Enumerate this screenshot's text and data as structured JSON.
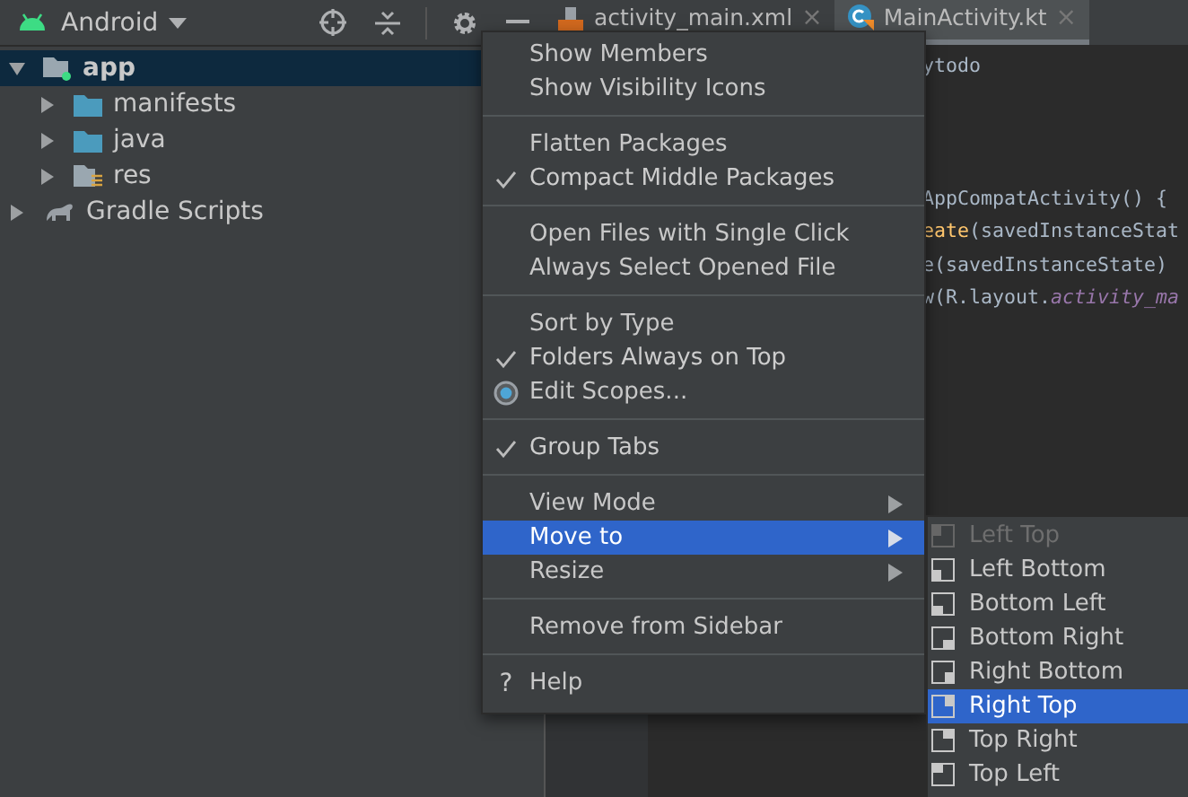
{
  "toolbar": {
    "view": "Android"
  },
  "tabs": [
    {
      "label": "activity_main.xml",
      "selected": false,
      "kind": "xml",
      "close": "×"
    },
    {
      "label": "MainActivity.kt",
      "selected": true,
      "kind": "kotlin",
      "close": "×"
    }
  ],
  "tree": [
    {
      "label": "app",
      "kind": "module",
      "expanded": true,
      "selected": true,
      "children": [
        {
          "label": "manifests",
          "kind": "folder",
          "expanded": false,
          "selected": false
        },
        {
          "label": "java",
          "kind": "folder",
          "expanded": false,
          "selected": false
        },
        {
          "label": "res",
          "kind": "res",
          "expanded": false,
          "selected": false
        }
      ]
    },
    {
      "label": "Gradle Scripts",
      "kind": "gradle",
      "expanded": false,
      "selected": false
    }
  ],
  "code": [
    [
      {
        "text": "ytodo",
        "kind": "plain"
      }
    ],
    [
      {
        "text": "AppCompatActivity() {",
        "kind": "plain"
      }
    ],
    [
      {
        "text": "eate",
        "kind": "function"
      },
      {
        "text": "(savedInstanceStat",
        "kind": "plain"
      }
    ],
    [
      {
        "text": "e(savedInstanceState)",
        "kind": "plain"
      }
    ],
    [
      {
        "text": "w(R.layout.",
        "kind": "plain"
      },
      {
        "text": "activity_ma",
        "kind": "field"
      }
    ]
  ],
  "menu": [
    {
      "kind": "toggle",
      "label": "Show Members",
      "checked": false,
      "selected": false
    },
    {
      "kind": "toggle",
      "label": "Show Visibility Icons",
      "checked": false,
      "selected": false
    },
    {
      "kind": "separator"
    },
    {
      "kind": "toggle",
      "label": "Flatten Packages",
      "checked": false,
      "selected": false
    },
    {
      "kind": "toggle",
      "label": "Compact Middle Packages",
      "checked": true,
      "selected": false
    },
    {
      "kind": "separator"
    },
    {
      "kind": "toggle",
      "label": "Open Files with Single Click",
      "checked": false,
      "selected": false
    },
    {
      "kind": "toggle",
      "label": "Always Select Opened File",
      "checked": false,
      "selected": false
    },
    {
      "kind": "separator"
    },
    {
      "kind": "toggle",
      "label": "Sort by Type",
      "checked": false,
      "selected": false
    },
    {
      "kind": "toggle",
      "label": "Folders Always on Top",
      "checked": true,
      "selected": false
    },
    {
      "kind": "radio",
      "label": "Edit Scopes...",
      "checked": true,
      "selected": false
    },
    {
      "kind": "separator"
    },
    {
      "kind": "toggle",
      "label": "Group Tabs",
      "checked": true,
      "selected": false
    },
    {
      "kind": "separator"
    },
    {
      "kind": "submenu",
      "label": "View Mode",
      "selected": false
    },
    {
      "kind": "submenu",
      "label": "Move to",
      "selected": true
    },
    {
      "kind": "submenu",
      "label": "Resize",
      "selected": false
    },
    {
      "kind": "separator"
    },
    {
      "kind": "action",
      "label": "Remove from Sidebar",
      "selected": false
    },
    {
      "kind": "separator"
    },
    {
      "kind": "help",
      "icon": "?",
      "label": "Help",
      "selected": false
    }
  ],
  "submenu": [
    {
      "label": "Left Top",
      "disabled": true,
      "selected": false
    },
    {
      "label": "Left Bottom",
      "disabled": false,
      "selected": false
    },
    {
      "label": "Bottom Left",
      "disabled": false,
      "selected": false
    },
    {
      "label": "Bottom Right",
      "disabled": false,
      "selected": false
    },
    {
      "label": "Right Bottom",
      "disabled": false,
      "selected": false
    },
    {
      "label": "Right Top",
      "disabled": false,
      "selected": true
    },
    {
      "label": "Top Right",
      "disabled": false,
      "selected": false
    },
    {
      "label": "Top Left",
      "disabled": false,
      "selected": false
    }
  ]
}
